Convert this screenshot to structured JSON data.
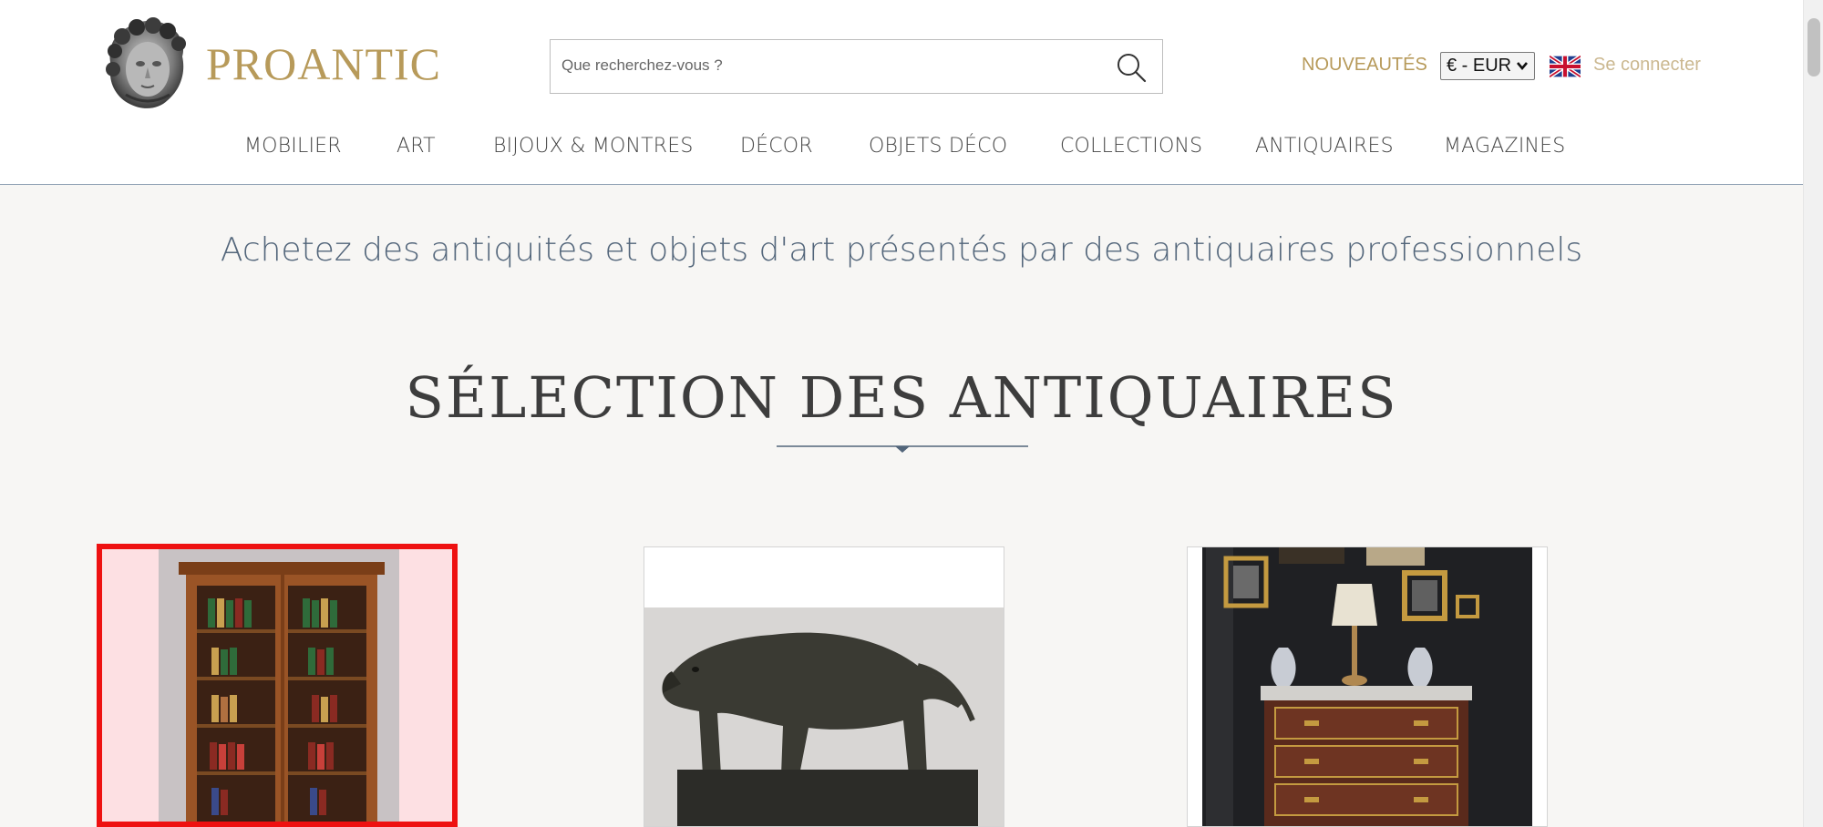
{
  "header": {
    "logo_text": "PROANTIC",
    "search_placeholder": "Que recherchez-vous ?",
    "nouveautes_label": "NOUVEAUTÉS",
    "currency_value": "€ - EUR",
    "language_flag": "uk-flag-icon",
    "connect_label": "Se connecter"
  },
  "nav": {
    "items": [
      "MOBILIER",
      "ART",
      "BIJOUX & MONTRES",
      "DÉCOR",
      "OBJETS DÉCO",
      "COLLECTIONS",
      "ANTIQUAIRES",
      "MAGAZINES"
    ]
  },
  "main": {
    "tagline": "Achetez des antiquités et objets d'art présentés par des antiquaires professionnels",
    "section_title": "SÉLECTION DES ANTIQUAIRES"
  },
  "colors": {
    "accent_gold": "#b79a5a",
    "tagline_blue": "#52657a",
    "selection_red": "#ee1111"
  }
}
